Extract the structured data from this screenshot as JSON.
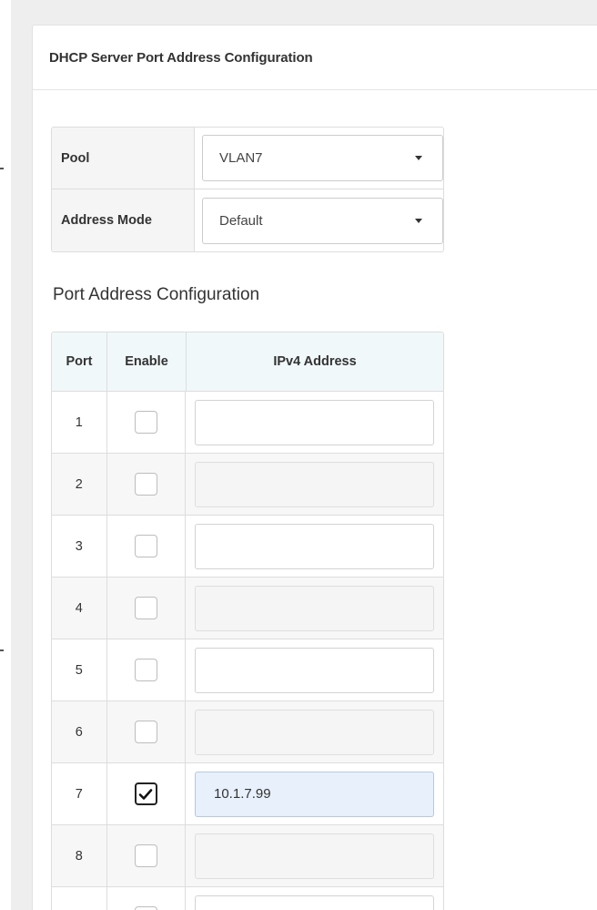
{
  "panel": {
    "title": "DHCP Server Port Address Configuration"
  },
  "form": {
    "pool_label": "Pool",
    "pool_value": "VLAN7",
    "mode_label": "Address Mode",
    "mode_value": "Default"
  },
  "section": {
    "title": "Port Address Configuration"
  },
  "table": {
    "headers": {
      "port": "Port",
      "enable": "Enable",
      "ip": "IPv4 Address"
    },
    "rows": [
      {
        "port": "1",
        "enabled": false,
        "ip": "",
        "state": "normal"
      },
      {
        "port": "2",
        "enabled": false,
        "ip": "",
        "state": "disabled"
      },
      {
        "port": "3",
        "enabled": false,
        "ip": "",
        "state": "normal"
      },
      {
        "port": "4",
        "enabled": false,
        "ip": "",
        "state": "disabled"
      },
      {
        "port": "5",
        "enabled": false,
        "ip": "",
        "state": "normal"
      },
      {
        "port": "6",
        "enabled": false,
        "ip": "",
        "state": "disabled"
      },
      {
        "port": "7",
        "enabled": true,
        "ip": "10.1.7.99",
        "state": "active"
      },
      {
        "port": "8",
        "enabled": false,
        "ip": "",
        "state": "disabled"
      },
      {
        "port": "",
        "enabled": false,
        "ip": "",
        "state": "normal"
      }
    ]
  },
  "icons": {
    "dropdown": "caret-down-icon",
    "check": "checkmark-icon"
  }
}
